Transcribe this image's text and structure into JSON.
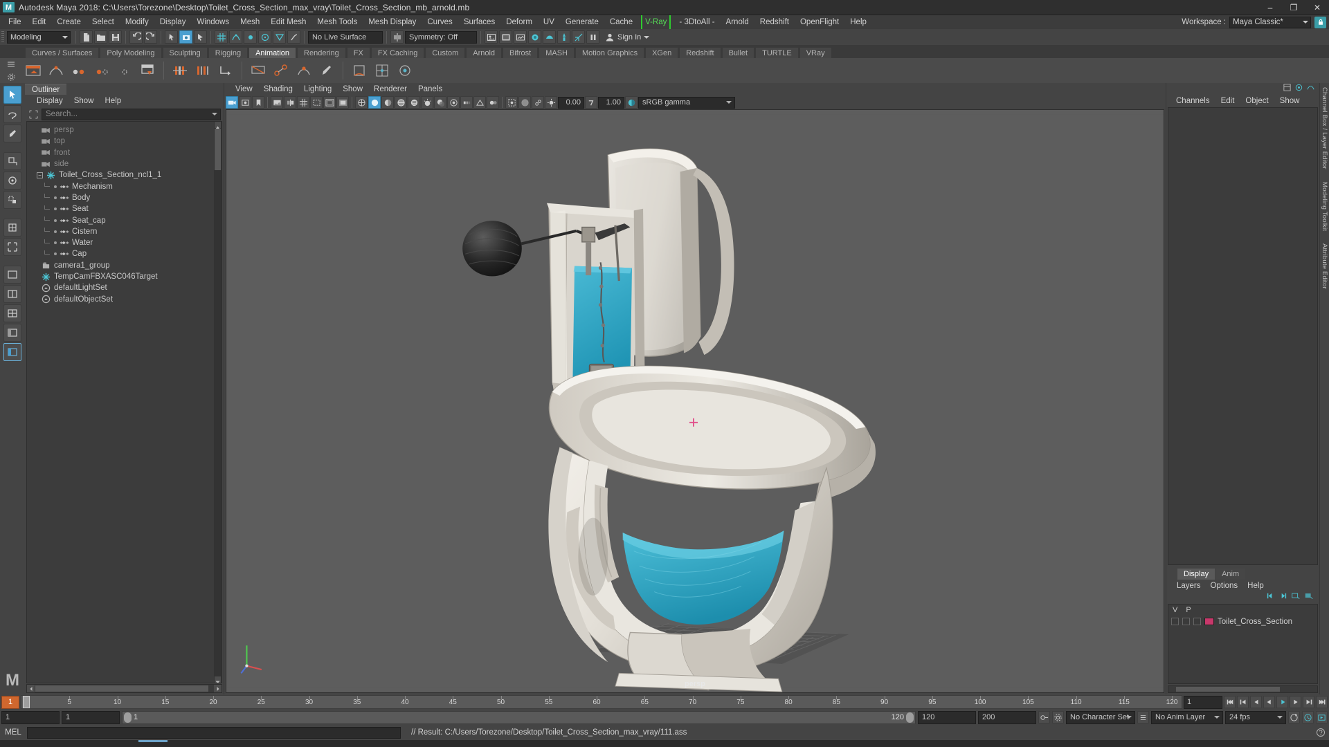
{
  "titlebar": {
    "app_title": "Autodesk Maya 2018: C:\\Users\\Torezone\\Desktop\\Toilet_Cross_Section_max_vray\\Toilet_Cross_Section_mb_arnold.mb",
    "logo_text": "M",
    "minimize": "–",
    "maximize": "❐",
    "close": "✕"
  },
  "menubar": {
    "items": [
      {
        "label": "File",
        "style": "normal"
      },
      {
        "label": "Edit",
        "style": "normal"
      },
      {
        "label": "Create",
        "style": "normal"
      },
      {
        "label": "Select",
        "style": "normal"
      },
      {
        "label": "Modify",
        "style": "normal"
      },
      {
        "label": "Display",
        "style": "normal"
      },
      {
        "label": "Windows",
        "style": "normal"
      },
      {
        "label": "Mesh",
        "style": "normal"
      },
      {
        "label": "Edit Mesh",
        "style": "normal"
      },
      {
        "label": "Mesh Tools",
        "style": "normal"
      },
      {
        "label": "Mesh Display",
        "style": "normal"
      },
      {
        "label": "Curves",
        "style": "normal"
      },
      {
        "label": "Surfaces",
        "style": "normal"
      },
      {
        "label": "Deform",
        "style": "normal"
      },
      {
        "label": "UV",
        "style": "normal"
      },
      {
        "label": "Generate",
        "style": "normal"
      },
      {
        "label": "Cache",
        "style": "normal"
      },
      {
        "label": "V-Ray",
        "style": "vray"
      },
      {
        "label": "- 3DtoAll -",
        "style": "normal"
      },
      {
        "label": "Arnold",
        "style": "normal"
      },
      {
        "label": "Redshift",
        "style": "normal"
      },
      {
        "label": "OpenFlight",
        "style": "normal"
      },
      {
        "label": "Help",
        "style": "normal"
      }
    ],
    "workspace_label": "Workspace :",
    "workspace_value": "Maya Classic*"
  },
  "statusline": {
    "mode_value": "Modeling",
    "live_surface_value": "No Live Surface",
    "symmetry_value": "Symmetry: Off",
    "signin_label": "Sign In"
  },
  "shelf": {
    "tabs": [
      {
        "label": "Curves / Surfaces",
        "active": false
      },
      {
        "label": "Poly Modeling",
        "active": false
      },
      {
        "label": "Sculpting",
        "active": false
      },
      {
        "label": "Rigging",
        "active": false
      },
      {
        "label": "Animation",
        "active": true
      },
      {
        "label": "Rendering",
        "active": false
      },
      {
        "label": "FX",
        "active": false
      },
      {
        "label": "FX Caching",
        "active": false
      },
      {
        "label": "Custom",
        "active": false
      },
      {
        "label": "Arnold",
        "active": false
      },
      {
        "label": "Bifrost",
        "active": false
      },
      {
        "label": "MASH",
        "active": false
      },
      {
        "label": "Motion Graphics",
        "active": false
      },
      {
        "label": "XGen",
        "active": false
      },
      {
        "label": "Redshift",
        "active": false
      },
      {
        "label": "Bullet",
        "active": false
      },
      {
        "label": "TURTLE",
        "active": false
      },
      {
        "label": "VRay",
        "active": false
      }
    ]
  },
  "outliner": {
    "tab_label": "Outliner",
    "menu": [
      "Display",
      "Show",
      "Help"
    ],
    "search_placeholder": "Search...",
    "items": [
      {
        "label": "persp",
        "icon": "camera-icon",
        "indent": 1,
        "dimmed": true,
        "expander": false,
        "tree": false
      },
      {
        "label": "top",
        "icon": "camera-icon",
        "indent": 1,
        "dimmed": true,
        "expander": false,
        "tree": false
      },
      {
        "label": "front",
        "icon": "camera-icon",
        "indent": 1,
        "dimmed": true,
        "expander": false,
        "tree": false
      },
      {
        "label": "side",
        "icon": "camera-icon",
        "indent": 1,
        "dimmed": true,
        "expander": false,
        "tree": false
      },
      {
        "label": "Toilet_Cross_Section_ncl1_1",
        "icon": "transform-icon",
        "indent": 0,
        "dimmed": false,
        "expander": true,
        "tree": false
      },
      {
        "label": "Mechanism",
        "icon": "mesh-icon",
        "indent": 2,
        "dimmed": false,
        "expander": false,
        "tree": true
      },
      {
        "label": "Body",
        "icon": "mesh-icon",
        "indent": 2,
        "dimmed": false,
        "expander": false,
        "tree": true
      },
      {
        "label": "Seat",
        "icon": "mesh-icon",
        "indent": 2,
        "dimmed": false,
        "expander": false,
        "tree": true
      },
      {
        "label": "Seat_cap",
        "icon": "mesh-icon",
        "indent": 2,
        "dimmed": false,
        "expander": false,
        "tree": true
      },
      {
        "label": "Cistern",
        "icon": "mesh-icon",
        "indent": 2,
        "dimmed": false,
        "expander": false,
        "tree": true
      },
      {
        "label": "Water",
        "icon": "mesh-icon",
        "indent": 2,
        "dimmed": false,
        "expander": false,
        "tree": true
      },
      {
        "label": "Cap",
        "icon": "mesh-icon",
        "indent": 2,
        "dimmed": false,
        "expander": false,
        "tree": true
      },
      {
        "label": "camera1_group",
        "icon": "group-icon",
        "indent": 1,
        "dimmed": false,
        "expander": false,
        "tree": false
      },
      {
        "label": "TempCamFBXASC046Target",
        "icon": "transform-icon",
        "indent": 1,
        "dimmed": false,
        "expander": false,
        "tree": false
      },
      {
        "label": "defaultLightSet",
        "icon": "set-icon",
        "indent": 1,
        "dimmed": false,
        "expander": false,
        "tree": false
      },
      {
        "label": "defaultObjectSet",
        "icon": "set-icon",
        "indent": 1,
        "dimmed": false,
        "expander": false,
        "tree": false
      }
    ]
  },
  "viewport": {
    "menu": [
      "View",
      "Shading",
      "Lighting",
      "Show",
      "Renderer",
      "Panels"
    ],
    "exposure_value": "0.00",
    "gamma_value": "1.00",
    "colorspace_value": "sRGB gamma",
    "camera_label": "persp"
  },
  "right_panel": {
    "menu": [
      "Channels",
      "Edit",
      "Object",
      "Show"
    ],
    "layer_tabs": [
      {
        "label": "Display",
        "active": true
      },
      {
        "label": "Anim",
        "active": false
      }
    ],
    "layer_menu": [
      "Layers",
      "Options",
      "Help"
    ],
    "layer_columns": [
      "V",
      "P"
    ],
    "layers": [
      {
        "name": "Toilet_Cross_Section",
        "color": "#c8386b",
        "visible": true
      }
    ],
    "vertical_tabs": [
      "Channel Box / Layer Editor",
      "Modeling Toolkit",
      "Attribute Editor"
    ]
  },
  "timeslider": {
    "current_frame": "1",
    "ticks": [
      5,
      10,
      15,
      20,
      25,
      30,
      35,
      40,
      45,
      50,
      55,
      60,
      65,
      70,
      75,
      80,
      85,
      90,
      95,
      100,
      105,
      110,
      115,
      120
    ],
    "end_field": "1"
  },
  "rangeslider": {
    "start_field": "1",
    "anim_start_field": "1",
    "range_start": "1",
    "range_end": "120",
    "playback_end": "120",
    "anim_end": "200",
    "character_set": "No Character Set",
    "anim_layer": "No Anim Layer",
    "fps": "24 fps"
  },
  "commandline": {
    "mel_label": "MEL",
    "input_value": "",
    "result_text": "// Result: C:/Users/Torezone/Desktop/Toilet_Cross_Section_max_vray/111.ass"
  },
  "colors": {
    "accent_blue": "#4a9fd0",
    "teal": "#3b9ea8",
    "orange": "#d0672e",
    "vray_green": "#56d956",
    "water_cyan": "#33aecb",
    "layer_pink": "#c8386b"
  }
}
